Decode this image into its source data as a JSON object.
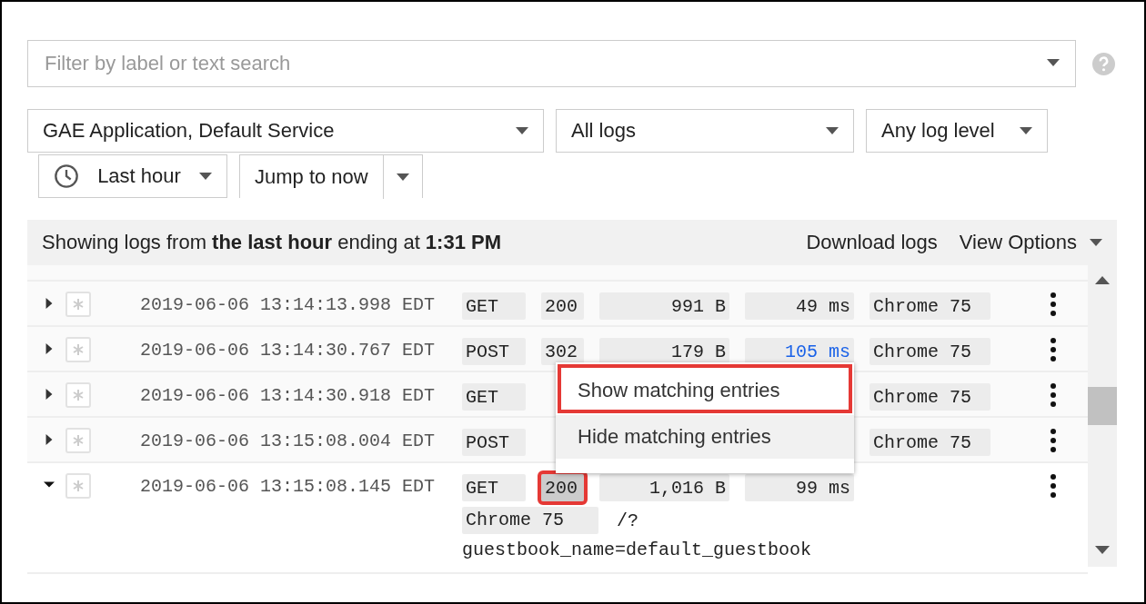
{
  "filter": {
    "placeholder": "Filter by label or text search"
  },
  "selectors": [
    {
      "label": "GAE Application, Default Service"
    },
    {
      "label": "All logs"
    },
    {
      "label": "Any log level"
    }
  ],
  "time_range": {
    "label": "Last hour"
  },
  "jump": {
    "label": "Jump to now"
  },
  "summary": "Showing logs from **the last hour** ending at **1:31 PM**",
  "actions": [
    "Download logs",
    "View Options"
  ],
  "rows": [
    {
      "expanded": false,
      "timestamp": "2019-06-06 13:14:13.998 EDT",
      "method": "GET",
      "status": "200",
      "size": "991 B",
      "latency": "49 ms",
      "latency_slow": false,
      "browser": "Chrome 75"
    },
    {
      "expanded": false,
      "timestamp": "2019-06-06 13:14:30.767 EDT",
      "method": "POST",
      "status": "302",
      "size": "179 B",
      "latency": "105 ms",
      "latency_slow": true,
      "browser": "Chrome 75"
    },
    {
      "expanded": false,
      "timestamp": "2019-06-06 13:14:30.918 EDT",
      "method": "GET",
      "browser": "Chrome 75"
    },
    {
      "expanded": false,
      "timestamp": "2019-06-06 13:15:08.004 EDT",
      "method": "POST",
      "browser": "Chrome 75"
    },
    {
      "expanded": true,
      "timestamp": "2019-06-06 13:15:08.145 EDT",
      "method": "GET",
      "status": "200",
      "status_annotated": true,
      "size": "1,016 B",
      "latency": "99 ms",
      "latency_slow": false,
      "browser": "Chrome 75",
      "url_lines": [
        "/?",
        "guestbook_name=default_guestbook"
      ]
    }
  ],
  "menu": [
    {
      "label": "Show matching entries",
      "annotated": true,
      "hovered": false
    },
    {
      "label": "Hide matching entries",
      "annotated": false,
      "hovered": true
    }
  ]
}
